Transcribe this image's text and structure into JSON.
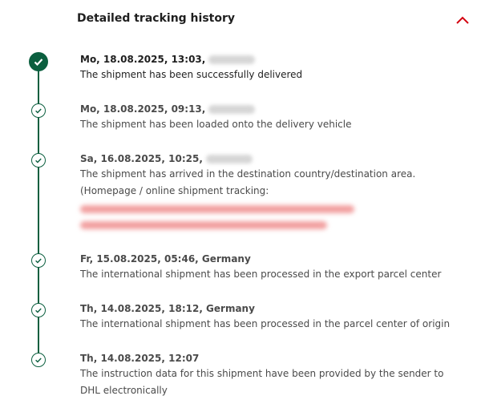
{
  "header": {
    "title": "Detailed tracking history"
  },
  "events": [
    {
      "when": "Mo, 18.08.2025, 13:03,",
      "desc": "The shipment has been successfully delivered"
    },
    {
      "when": "Mo, 18.08.2025, 09:13,",
      "desc": "The shipment has been loaded onto the delivery vehicle"
    },
    {
      "when": "Sa, 16.08.2025, 10:25,",
      "desc": "The shipment has arrived in the destination country/destination area.",
      "desc2": "(Homepage / online shipment tracking:"
    },
    {
      "when": "Fr, 15.08.2025, 05:46, Germany",
      "desc": "The international shipment has been processed in the export parcel center"
    },
    {
      "when": "Th, 14.08.2025, 18:12, Germany",
      "desc": "The international shipment has been processed in the parcel center of origin"
    },
    {
      "when": "Th, 14.08.2025, 12:07",
      "desc": "The instruction data for this shipment have been provided by the sender to DHL electronically"
    }
  ],
  "icons": {
    "collapse": "chevron-up-icon",
    "marker": "check-circle-icon"
  },
  "colors": {
    "accent_green": "#0b5f3f",
    "chevron_red": "#d40511"
  }
}
